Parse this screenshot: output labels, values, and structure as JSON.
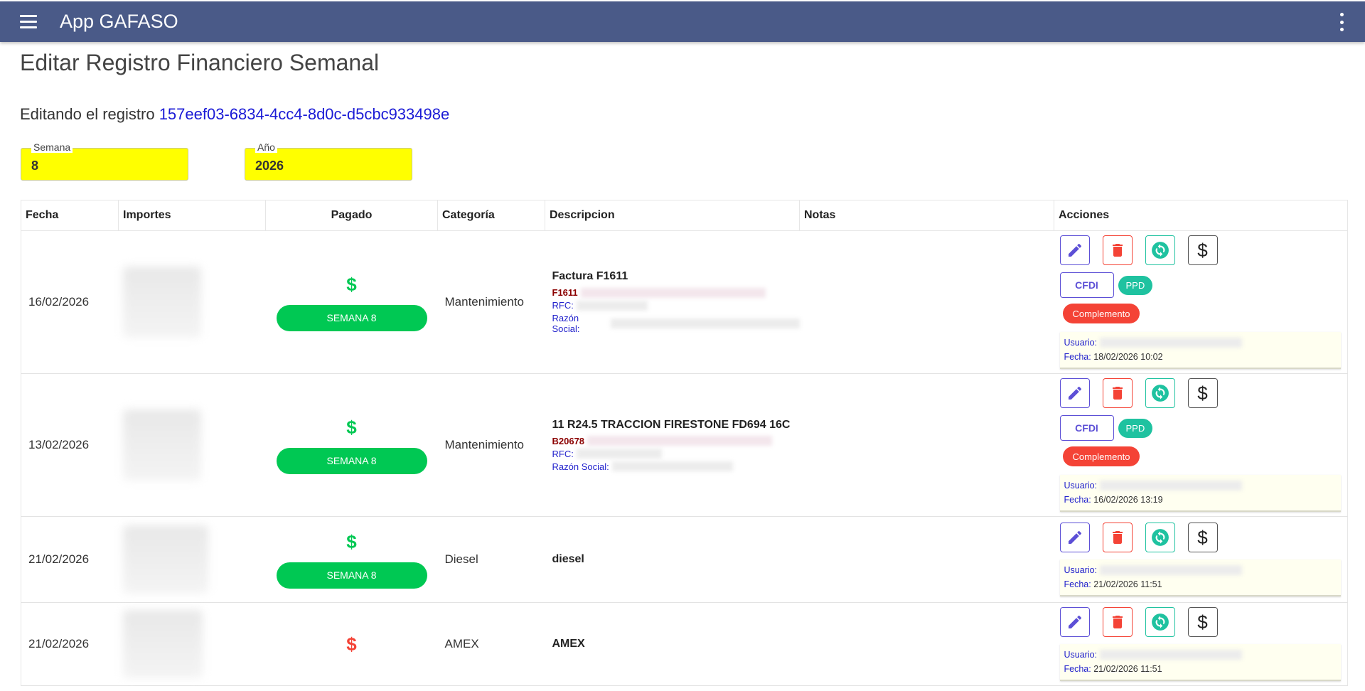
{
  "app": {
    "title": "App GAFASO"
  },
  "page": {
    "title": "Editar Registro Financiero Semanal",
    "editing_prefix": "Editando el registro",
    "record_id": "157eef03-6834-4cc4-8d0c-d5cbc933498e"
  },
  "fields": {
    "semana": {
      "label": "Semana",
      "value": "8"
    },
    "anio": {
      "label": "Año",
      "value": "2026"
    }
  },
  "table": {
    "headers": [
      "Fecha",
      "Importes",
      "Pagado",
      "Categoría",
      "Descripcion",
      "Notas",
      "Acciones"
    ],
    "rows": [
      {
        "fecha": "16/02/2026",
        "pagado_status": "paid",
        "semana_label": "SEMANA 8",
        "categoria": "Mantenimiento",
        "desc_title": "Factura F1611",
        "desc_code": "F1611",
        "rfc_label": "RFC:",
        "razon_label": "Razón Social:",
        "cfdi_label": "CFDI",
        "ppd_label": "PPD",
        "complemento_label": "Complemento",
        "usuario_label": "Usuario:",
        "fecha_label": "Fecha:",
        "fecha_value": "18/02/2026 10:02"
      },
      {
        "fecha": "13/02/2026",
        "pagado_status": "paid",
        "semana_label": "SEMANA 8",
        "categoria": "Mantenimiento",
        "desc_title": "11 R24.5 TRACCION FIRESTONE FD694 16C",
        "desc_code": "B20678",
        "rfc_label": "RFC:",
        "razon_label": "Razón Social:",
        "cfdi_label": "CFDI",
        "ppd_label": "PPD",
        "complemento_label": "Complemento",
        "usuario_label": "Usuario:",
        "fecha_label": "Fecha:",
        "fecha_value": "16/02/2026 13:19"
      },
      {
        "fecha": "21/02/2026",
        "pagado_status": "paid",
        "semana_label": "SEMANA 8",
        "categoria": "Diesel",
        "desc_title": "diesel",
        "usuario_label": "Usuario:",
        "fecha_label": "Fecha:",
        "fecha_value": "21/02/2026 11:51"
      },
      {
        "fecha": "21/02/2026",
        "pagado_status": "unpaid",
        "categoria": "AMEX",
        "desc_title": "AMEX",
        "usuario_label": "Usuario:",
        "fecha_label": "Fecha:",
        "fecha_value": "21/02/2026 11:51"
      }
    ]
  },
  "icons": {
    "dollar": "$",
    "edit": "pencil-icon",
    "delete": "trash-icon",
    "sync": "sync-icon",
    "pay": "dollar-icon"
  },
  "colors": {
    "appbar": "#4a5a88",
    "field_bg": "#ffff00",
    "paid_green": "#00c853",
    "unpaid_red": "#f44336",
    "link_blue": "#1a1ad6",
    "ppd_teal": "#1fc2a0"
  }
}
